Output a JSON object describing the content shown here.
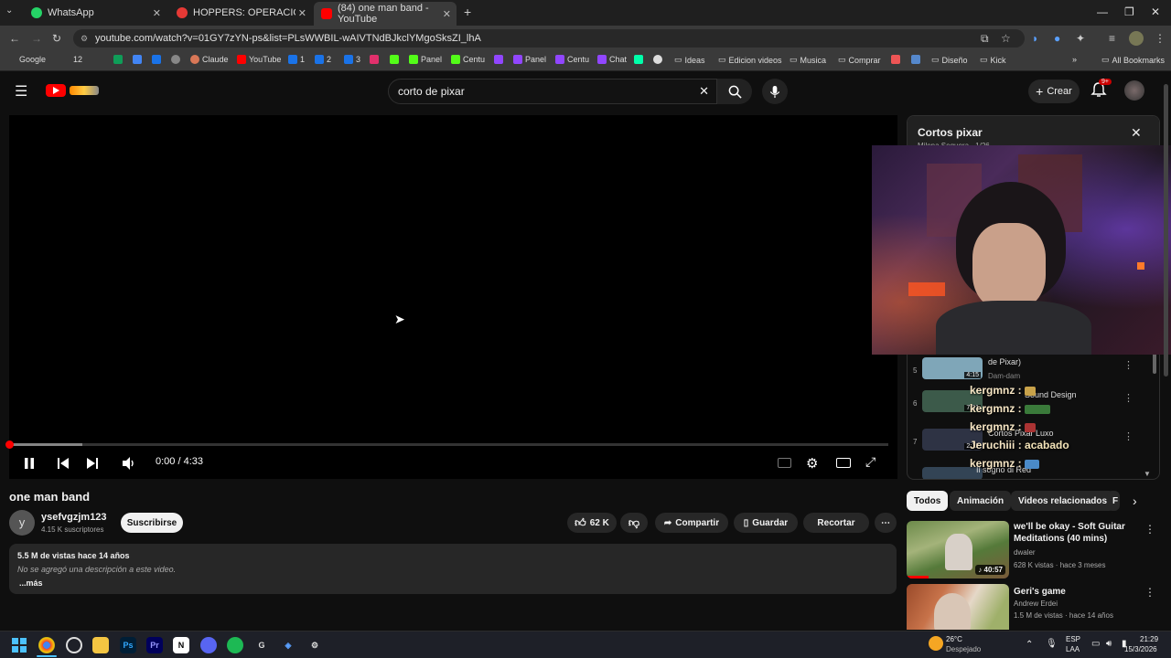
{
  "browser": {
    "tabs": [
      {
        "label": "WhatsApp",
        "active": false
      },
      {
        "label": "HOPPERS: OPERACIÓN CASTOR",
        "active": false
      },
      {
        "label": "(84) one man band - YouTube",
        "active": true
      }
    ],
    "new_tab": "+",
    "url": "youtube.com/watch?v=01GY7zYN-ps&list=PLsWWBIL-wAIVTNdBJkclYMgoSksZI_lhA",
    "bookmarks": [
      {
        "label": "Google",
        "color": "#4285f4"
      },
      {
        "label": "12",
        "color": "#25d366"
      },
      {
        "label": "Claude",
        "color": "#d97757"
      },
      {
        "label": "YouTube",
        "color": "#ff0000"
      },
      {
        "label": "1",
        "color": "#1a73e8"
      },
      {
        "label": "2",
        "color": "#1a73e8"
      },
      {
        "label": "3",
        "color": "#1a73e8"
      },
      {
        "label": "Panel",
        "color": "#53fc18"
      },
      {
        "label": "Centu",
        "color": "#53fc18"
      },
      {
        "label": "Panel",
        "color": "#9146ff"
      },
      {
        "label": "Centu",
        "color": "#9146ff"
      },
      {
        "label": "Chat",
        "color": "#9146ff"
      },
      {
        "label": "Ideas",
        "color": "#cccccc"
      },
      {
        "label": "Edicion videos",
        "color": "#cccccc"
      },
      {
        "label": "Musica",
        "color": "#cccccc"
      },
      {
        "label": "Comprar",
        "color": "#cccccc"
      },
      {
        "label": "Diseño",
        "color": "#cccccc"
      },
      {
        "label": "Kick",
        "color": "#cccccc"
      }
    ],
    "all_bookmarks": "All Bookmarks"
  },
  "header": {
    "search_value": "corto de pixar",
    "create_label": "Crear",
    "notif_badge": "9+"
  },
  "player": {
    "time": "0:00 / 4:33",
    "progress_fraction": 0.0,
    "buffered_fraction": 0.083
  },
  "video": {
    "title": "one man band",
    "avatar_letter": "y",
    "channel": "ysefvgzjm123",
    "subs": "4.15 K suscriptores",
    "subscribe": "Suscribirse",
    "likes": "62 K",
    "share": "Compartir",
    "save": "Guardar",
    "clip": "Recortar",
    "views": "5.5 M de vistas  hace 14 años",
    "description": "No se agregó una descripción a este video.",
    "more": "...más"
  },
  "playlist": {
    "title": "Cortos pixar",
    "subtitle": "Milena Sequera · 1/26",
    "items": [
      {
        "index": "5",
        "title": "de Pixar)",
        "channel": "Dam-dam",
        "duration": "4:15",
        "color": "#7fa6b8"
      },
      {
        "index": "6",
        "title": "Sound Design",
        "channel": "",
        "duration": "7:31",
        "color": "#3c5a4a"
      },
      {
        "index": "7",
        "title": "Cortos Pixar Luxo",
        "channel": "",
        "duration": "2:12",
        "color": "#2e3344"
      },
      {
        "index": "",
        "title": "Il sogno di Red",
        "channel": "",
        "duration": "",
        "color": "#334455"
      }
    ]
  },
  "chat": [
    {
      "user": "kergmnz :",
      "msg": ""
    },
    {
      "user": "kergmnz :",
      "msg": ""
    },
    {
      "user": "kergmnz :",
      "msg": ""
    },
    {
      "user": "Jeruchiii :",
      "msg": "acabado"
    },
    {
      "user": "kergmnz :",
      "msg": ""
    }
  ],
  "chips": [
    "Todos",
    "Animación",
    "Videos relacionados",
    "F"
  ],
  "recommended": [
    {
      "title": "we'll be okay - Soft Guitar Meditations (40 mins)",
      "channel": "dwaler",
      "meta": "628 K vistas · hace 3 meses",
      "duration": "40:57"
    },
    {
      "title": "Geri's game",
      "channel": "Andrew Erdei",
      "meta": "1.5 M de vistas · hace 14 años",
      "duration": ""
    }
  ],
  "taskbar": {
    "weather_temp": "26°C",
    "weather_desc": "Despejado",
    "lang_top": "ESP",
    "lang_bottom": "LAA",
    "time": "21:29",
    "date": "15/3/2026"
  }
}
